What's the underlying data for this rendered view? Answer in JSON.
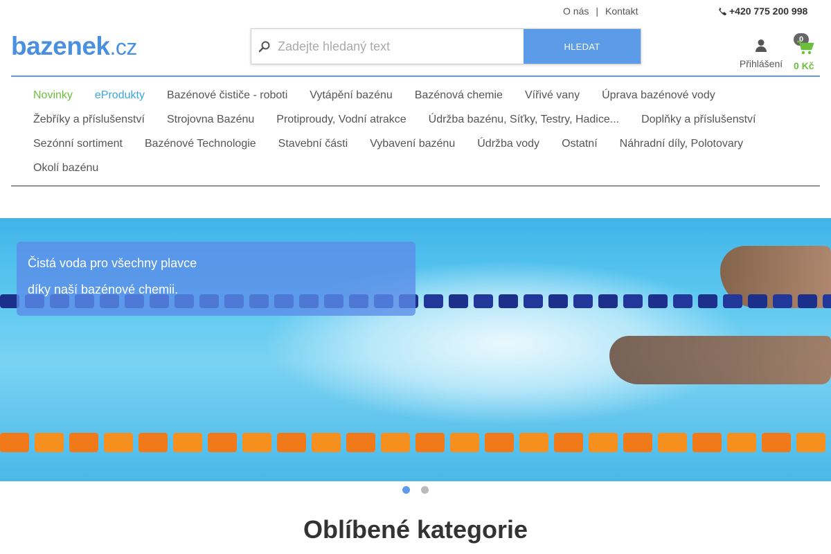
{
  "topbar": {
    "about_label": "O nás",
    "separator": "|",
    "contact_label": "Kontakt",
    "phone": "+420 775 200 998"
  },
  "logo": {
    "name": "bazenek",
    "domain": ".cz",
    "color": "#4a8fe0"
  },
  "search": {
    "placeholder": "Zadejte hledaný text",
    "button_label": "HLEDAT",
    "accent": "#5b9be8"
  },
  "account": {
    "login_label": "Přihlášení",
    "icon": "user-icon"
  },
  "cart": {
    "count": "0",
    "total": "0 Kč",
    "icon": "shopping-cart-icon",
    "accent": "#6cbf3c"
  },
  "nav": {
    "items": [
      {
        "label": "Novinky",
        "color": "green"
      },
      {
        "label": "eProdukty",
        "color": "blue"
      },
      {
        "label": "Bazénové čističe - roboti"
      },
      {
        "label": "Vytápění bazénu"
      },
      {
        "label": "Bazénová chemie"
      },
      {
        "label": "Vířivé vany"
      },
      {
        "label": "Úprava bazénové vody"
      },
      {
        "label": "Žebříky a příslušenství"
      },
      {
        "label": "Strojovna Bazénu"
      },
      {
        "label": "Protiproudy, Vodní atrakce"
      },
      {
        "label": "Údržba bazénu, Síťky, Testry, Hadice..."
      },
      {
        "label": "Doplňky a příslušenství"
      },
      {
        "label": "Sezónní sortiment"
      },
      {
        "label": "Bazénové Technologie"
      },
      {
        "label": "Stavební části"
      },
      {
        "label": "Vybavení bazénu"
      },
      {
        "label": "Údržba vody"
      },
      {
        "label": "Ostatní"
      },
      {
        "label": "Náhradní díly, Polotovary"
      },
      {
        "label": "Okolí bazénu"
      }
    ]
  },
  "hero": {
    "caption_line1": "Čistá voda pro všechny plavce",
    "caption_line2": "díky naší bazénové chemii.",
    "slides": 2,
    "active_slide": 1
  },
  "section": {
    "title": "Oblíbené kategorie"
  }
}
